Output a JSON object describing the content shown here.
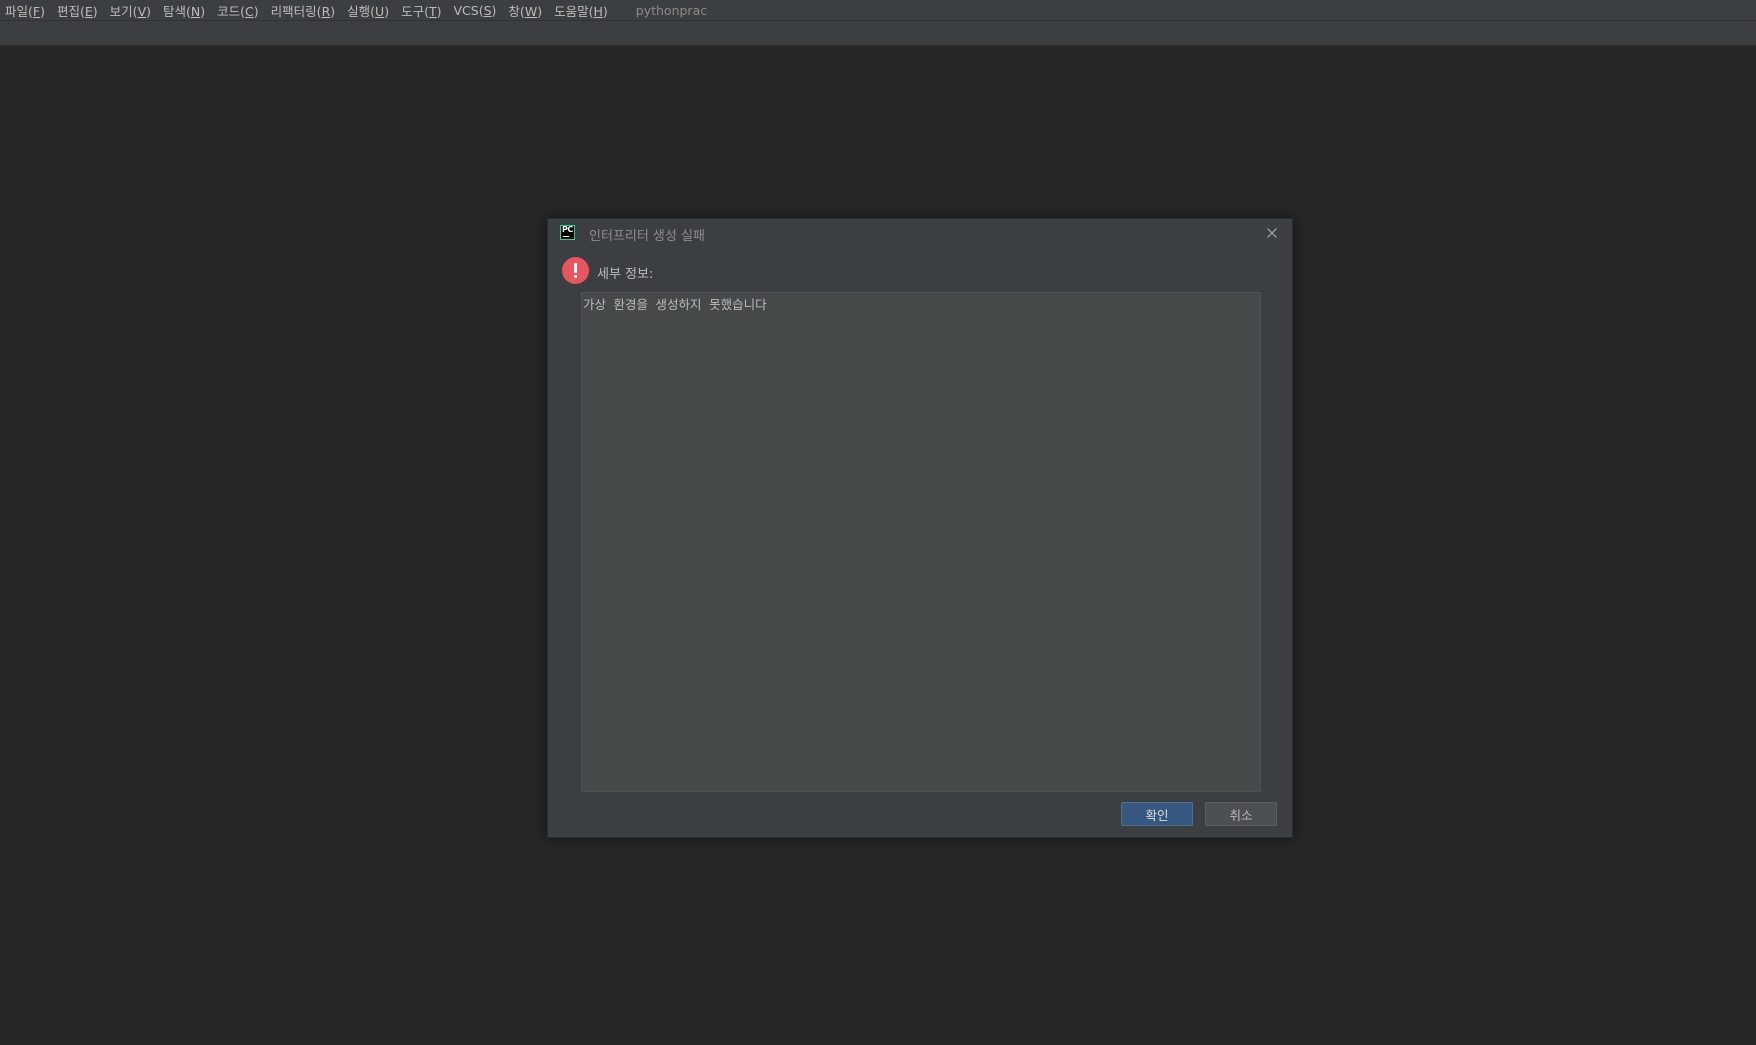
{
  "menubar": {
    "items": [
      {
        "label": "파일(",
        "mnemonic": "F",
        "close": ")"
      },
      {
        "label": "편집(",
        "mnemonic": "E",
        "close": ")"
      },
      {
        "label": "보기(",
        "mnemonic": "V",
        "close": ")"
      },
      {
        "label": "탐색(",
        "mnemonic": "N",
        "close": ")"
      },
      {
        "label": "코드(",
        "mnemonic": "C",
        "close": ")"
      },
      {
        "label": "리팩터링(",
        "mnemonic": "R",
        "close": ")"
      },
      {
        "label": "실행(",
        "mnemonic": "U",
        "close": ")"
      },
      {
        "label": "도구(",
        "mnemonic": "T",
        "close": ")"
      },
      {
        "label": "VCS(",
        "mnemonic": "S",
        "close": ")"
      },
      {
        "label": "창(",
        "mnemonic": "W",
        "close": ")"
      },
      {
        "label": "도움말(",
        "mnemonic": "H",
        "close": ")"
      }
    ],
    "project_name": "pythonprac"
  },
  "dialog": {
    "app_icon": "pycharm-icon",
    "title": "인터프리터 생성 실패",
    "close_icon": "close-icon",
    "status_icon": "error-icon",
    "details_label": "세부 정보:",
    "details_text": "가상 환경을 생성하지 못했습니다",
    "ok_label": "확인",
    "cancel_label": "취소"
  },
  "colors": {
    "background": "#272727",
    "dialog": "#3c3f41",
    "text_area": "#45494a",
    "ok_button": "#365880",
    "error": "#e8555f"
  }
}
